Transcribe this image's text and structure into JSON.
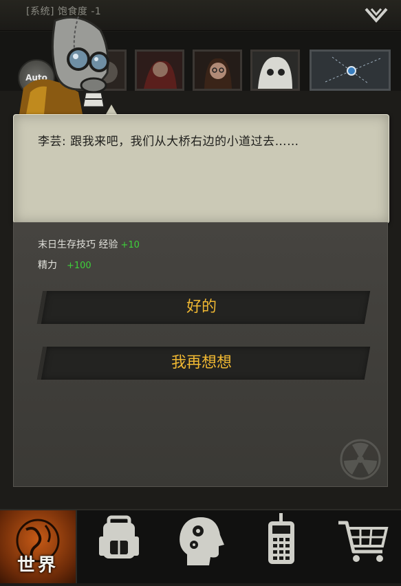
{
  "system_bar": {
    "text": "[系统] 饱食度 -1"
  },
  "party": {
    "auto_label": "Auto"
  },
  "dialog": {
    "text": "李芸: 跟我来吧，我们从大桥右边的小道过去……"
  },
  "rewards": [
    {
      "label": "末日生存技巧 经验",
      "amount": "+10"
    },
    {
      "label": "精力",
      "amount": "+100"
    }
  ],
  "choices": [
    {
      "label": "好的"
    },
    {
      "label": "我再想想"
    }
  ],
  "nav": {
    "world_label": "世界",
    "icons": [
      "globe-icon",
      "backpack-icon",
      "skills-head-icon",
      "radio-icon",
      "cart-icon"
    ]
  },
  "colors": {
    "choice_text": "#f0b832",
    "reward_amount": "#3ed13a",
    "world_tab": "#c65a16"
  }
}
